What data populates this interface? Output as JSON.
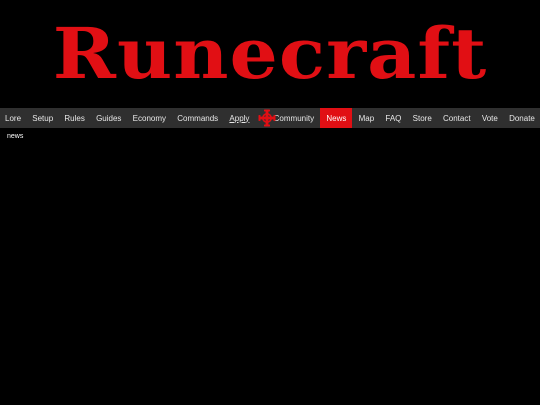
{
  "site": {
    "logo_text": "Runecraft"
  },
  "nav": {
    "items": [
      {
        "label": "Lore"
      },
      {
        "label": "Setup"
      },
      {
        "label": "Rules"
      },
      {
        "label": "Guides"
      },
      {
        "label": "Economy"
      },
      {
        "label": "Commands"
      },
      {
        "label": "Apply"
      },
      {
        "label": "Community",
        "icon": "celtic-cross-icon"
      },
      {
        "label": "News",
        "active": true
      },
      {
        "label": "Map"
      },
      {
        "label": "FAQ"
      },
      {
        "label": "Store"
      },
      {
        "label": "Contact"
      },
      {
        "label": "Vote"
      },
      {
        "label": "Donate"
      }
    ]
  },
  "main": {
    "text": "news"
  },
  "colors": {
    "brand_red": "#e10f14",
    "nav_bg": "#2f2f2f",
    "page_bg": "#000000"
  }
}
